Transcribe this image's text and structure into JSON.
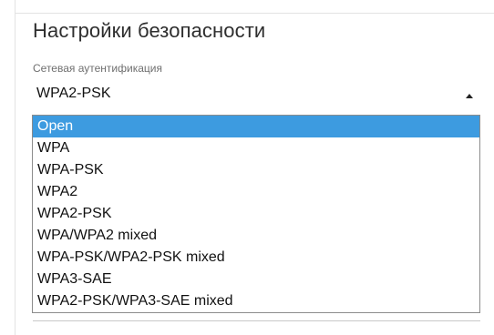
{
  "security": {
    "title": "Настройки безопасности",
    "auth_label": "Сетевая аутентификация",
    "auth_value": "WPA2-PSK",
    "options": [
      "Open",
      "WPA",
      "WPA-PSK",
      "WPA2",
      "WPA2-PSK",
      "WPA/WPA2 mixed",
      "WPA-PSK/WPA2-PSK mixed",
      "WPA3-SAE",
      "WPA2-PSK/WPA3-SAE mixed"
    ],
    "highlighted_option_index": 0
  },
  "icons": {
    "dropdown_caret": "caret-up-icon"
  },
  "colors": {
    "highlight": "#3d9be0",
    "title_text": "#2e2e2e",
    "label_text": "#6f6f6f"
  }
}
